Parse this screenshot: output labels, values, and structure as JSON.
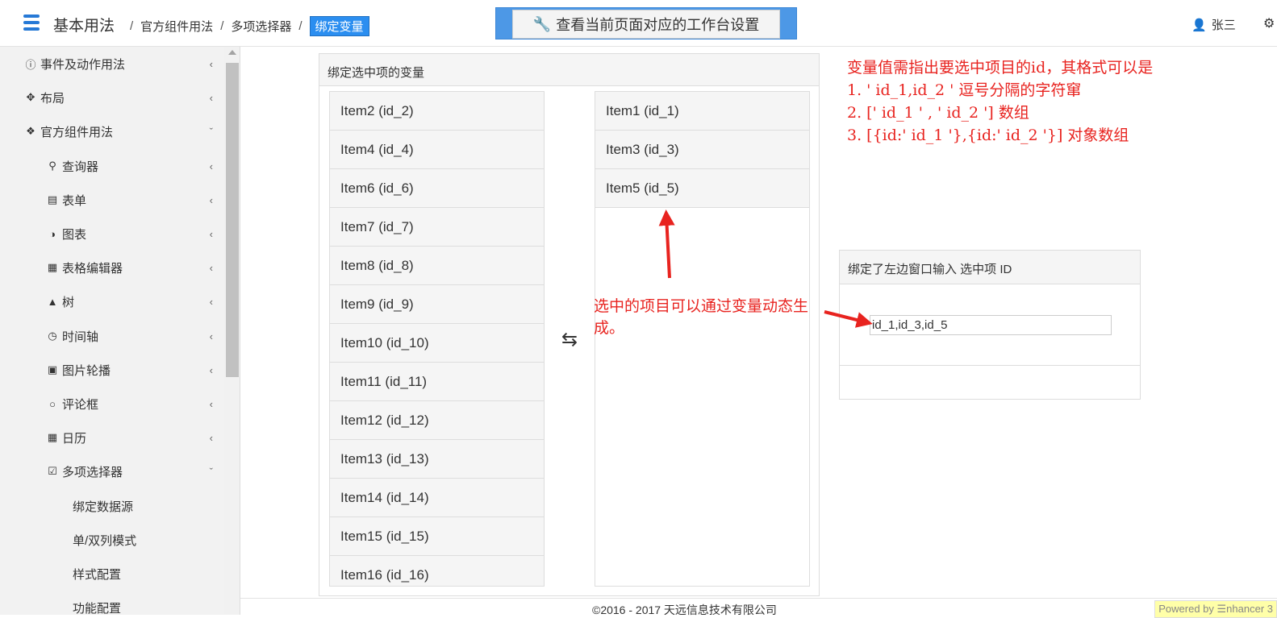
{
  "header": {
    "title": "基本用法",
    "breadcrumbs": [
      "官方组件用法",
      "多项选择器"
    ],
    "breadcrumb_active": "绑定变量",
    "workspace_button": "查看当前页面对应的工作台设置",
    "user_name": "张三"
  },
  "sidebar": {
    "items": [
      {
        "label": "事件及动作用法",
        "icon": "info-icon"
      },
      {
        "label": "布局",
        "icon": "move-icon"
      },
      {
        "label": "官方组件用法",
        "icon": "puzzle-icon"
      },
      {
        "label": "查询器",
        "icon": "search-icon"
      },
      {
        "label": "表单",
        "icon": "form-icon"
      },
      {
        "label": "图表",
        "icon": "pie-chart-icon"
      },
      {
        "label": "表格编辑器",
        "icon": "table-icon"
      },
      {
        "label": "树",
        "icon": "sitemap-icon"
      },
      {
        "label": "时间轴",
        "icon": "clock-icon"
      },
      {
        "label": "图片轮播",
        "icon": "image-icon"
      },
      {
        "label": "评论框",
        "icon": "comment-icon"
      },
      {
        "label": "日历",
        "icon": "calendar-icon"
      },
      {
        "label": "多项选择器",
        "icon": "checkbox-icon"
      },
      {
        "label": "绑定数据源"
      },
      {
        "label": "单/双列模式"
      },
      {
        "label": "样式配置"
      },
      {
        "label": "功能配置"
      }
    ]
  },
  "panel": {
    "title": "绑定选中项的变量",
    "left_items": [
      "Item2 (id_2)",
      "Item4 (id_4)",
      "Item6 (id_6)",
      "Item7 (id_7)",
      "Item8 (id_8)",
      "Item9 (id_9)",
      "Item10 (id_10)",
      "Item11 (id_11)",
      "Item12 (id_12)",
      "Item13 (id_13)",
      "Item14 (id_14)",
      "Item15 (id_15)",
      "Item16 (id_16)"
    ],
    "right_items": [
      "Item1 (id_1)",
      "Item3 (id_3)",
      "Item5 (id_5)"
    ],
    "annotation": "选中的项目可以通过变量动态生成。"
  },
  "note": {
    "lines": [
      "变量值需指出要选中项目的id，其格式可以是",
      "1. ' id_1,id_2 ' 逗号分隔的字符窜",
      "2. [' id_1 ' , ' id_2 '] 数组",
      "3. [{id:' id_1 '},{id:' id_2 '}] 对象数组"
    ]
  },
  "bound_box": {
    "title": "绑定了左边窗口输入 选中项 ID",
    "input_value": "id_1,id_3,id_5"
  },
  "footer": {
    "copyright": "©2016 - 2017 天远信息技术有限公司",
    "powered": "Powered by ☰nhancer 3"
  },
  "colors": {
    "accent": "#2b8ef0",
    "annotation": "#e8231f"
  }
}
